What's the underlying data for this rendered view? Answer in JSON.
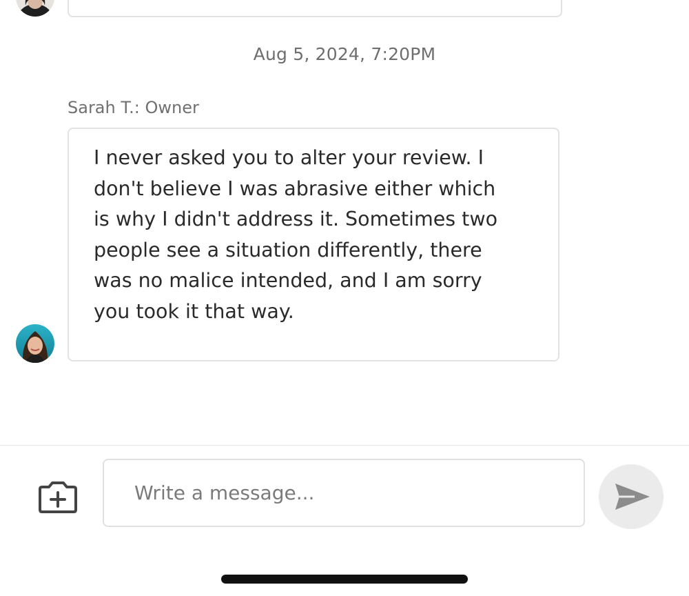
{
  "conversation": {
    "previous_message": {
      "avatar_icon": "user-photo-avatar"
    },
    "timestamp": "Aug 5, 2024, 7:20PM",
    "message": {
      "sender": "Sarah T.: Owner",
      "text": "I never asked you to alter your review. I\ndon't believe I was abrasive either which\nis why I didn't address it. Sometimes two\npeople see a situation differently, there\nwas no malice intended, and I am sorry\nyou took it that way.",
      "avatar_icon": "owner-photo-avatar"
    }
  },
  "composer": {
    "attach_icon": "camera-plus-icon",
    "input_value": "",
    "input_placeholder": "Write a message...",
    "send_icon": "send-arrow-icon",
    "colors": {
      "send_button_bg": "#ebebeb",
      "send_icon": "#8c8c8c",
      "attach_icon": "#444444"
    }
  }
}
